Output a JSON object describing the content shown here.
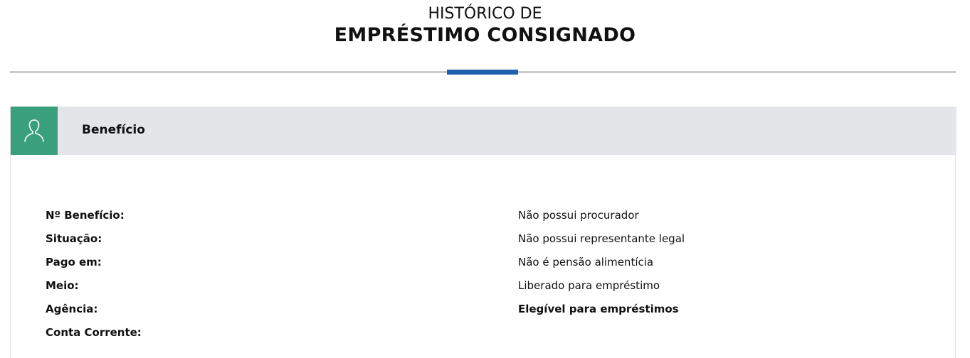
{
  "header": {
    "title_line1": "HISTÓRICO DE",
    "title_line2": "EMPRÉSTIMO CONSIGNADO"
  },
  "card": {
    "icon": "user-icon",
    "title": "Benefício",
    "colors": {
      "icon_bg": "#3a9f7c",
      "header_bg": "#e3e5e9",
      "accent": "#1f5fb0"
    }
  },
  "fields_left": [
    "Nº Benefício:",
    "Situação:",
    "Pago em:",
    "Meio:",
    "Agência:",
    "Conta Corrente:"
  ],
  "status_right": [
    "Não possui procurador",
    "Não possui representante legal",
    "Não é pensão alimentícia",
    "Liberado para empréstimo",
    "Elegível para empréstimos"
  ]
}
